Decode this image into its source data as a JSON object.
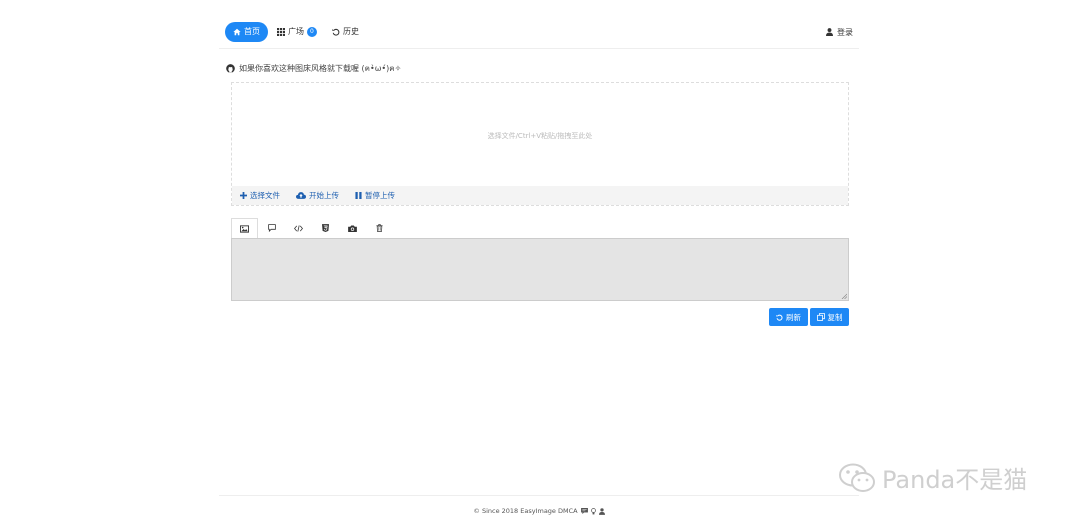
{
  "nav": {
    "home": "首页",
    "square": "广场",
    "square_badge": "0",
    "history": "历史",
    "login": "登录"
  },
  "notice": "如果你喜欢这种图床风格就下载喔 (ฅ•̀ω•́)ฅ✧",
  "dropzone": {
    "hint": "选择文件/Ctrl+V粘贴/拖拽至此处",
    "select": "选择文件",
    "start": "开始上传",
    "pause": "暂停上传"
  },
  "tabs": [
    "image-icon",
    "comment-icon",
    "code-icon",
    "html5-icon",
    "camera-icon",
    "trash-icon"
  ],
  "actions": {
    "refresh": "刷新",
    "copy": "复制"
  },
  "footer": "© Since 2018 EasyImage DMCA",
  "watermark": "Panda不是猫",
  "colors": {
    "accent": "#1e88f5",
    "link": "#1e5fb0"
  }
}
